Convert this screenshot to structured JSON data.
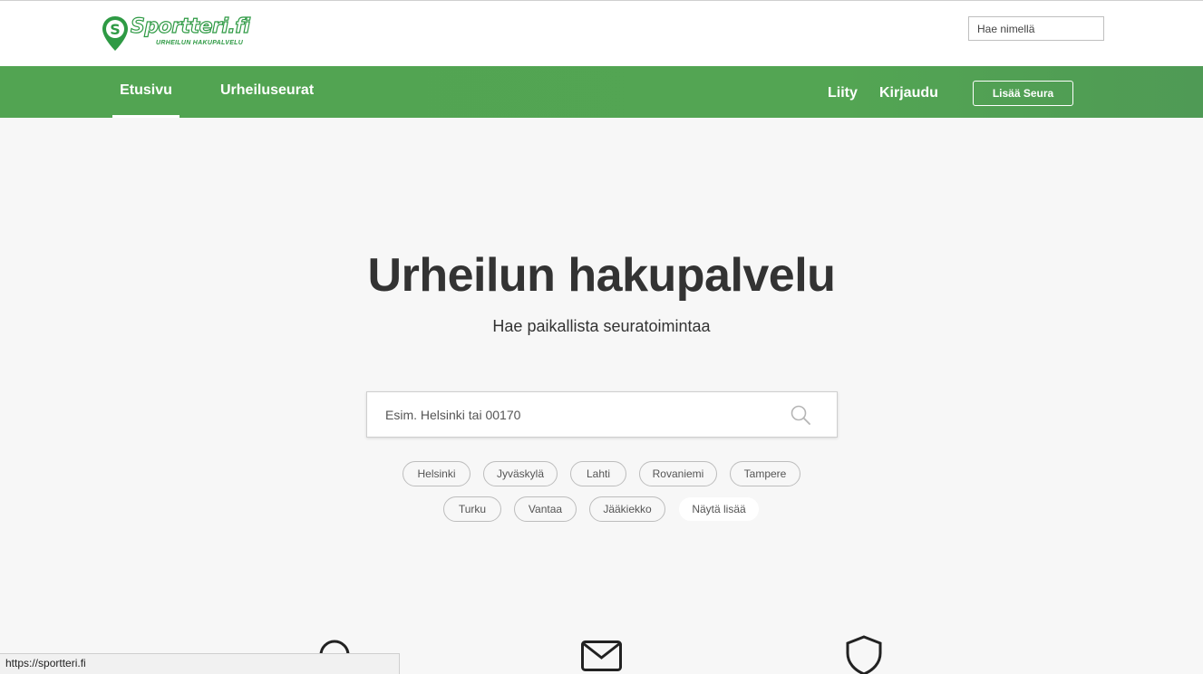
{
  "header": {
    "logo_text": "Sportteri.fi",
    "logo_tagline": "URHEILUN HAKUPALVELU",
    "name_search_placeholder": "Hae nimellä"
  },
  "nav": {
    "items": [
      {
        "label": "Etusivu",
        "active": true
      },
      {
        "label": "Urheiluseurat",
        "active": false
      }
    ],
    "join_label": "Liity",
    "login_label": "Kirjaudu",
    "add_club_label": "Lisää Seura"
  },
  "hero": {
    "title": "Urheilun hakupalvelu",
    "subtitle": "Hae paikallista seuratoimintaa",
    "search_placeholder": "Esim. Helsinki tai 00170"
  },
  "quick_links": {
    "row1": [
      "Helsinki",
      "Jyväskylä",
      "Lahti",
      "Rovaniemi",
      "Tampere"
    ],
    "row2": [
      "Turku",
      "Vantaa",
      "Jääkiekko"
    ],
    "show_more": "Näytä lisää"
  },
  "features": {
    "icons": [
      "search-icon",
      "envelope-icon",
      "shield-icon"
    ]
  },
  "status_bar": {
    "url": "https://sportteri.fi"
  },
  "colors": {
    "nav_green": "#53a553",
    "brand_green": "#2e9a44",
    "page_bg": "#f7f7f7"
  }
}
